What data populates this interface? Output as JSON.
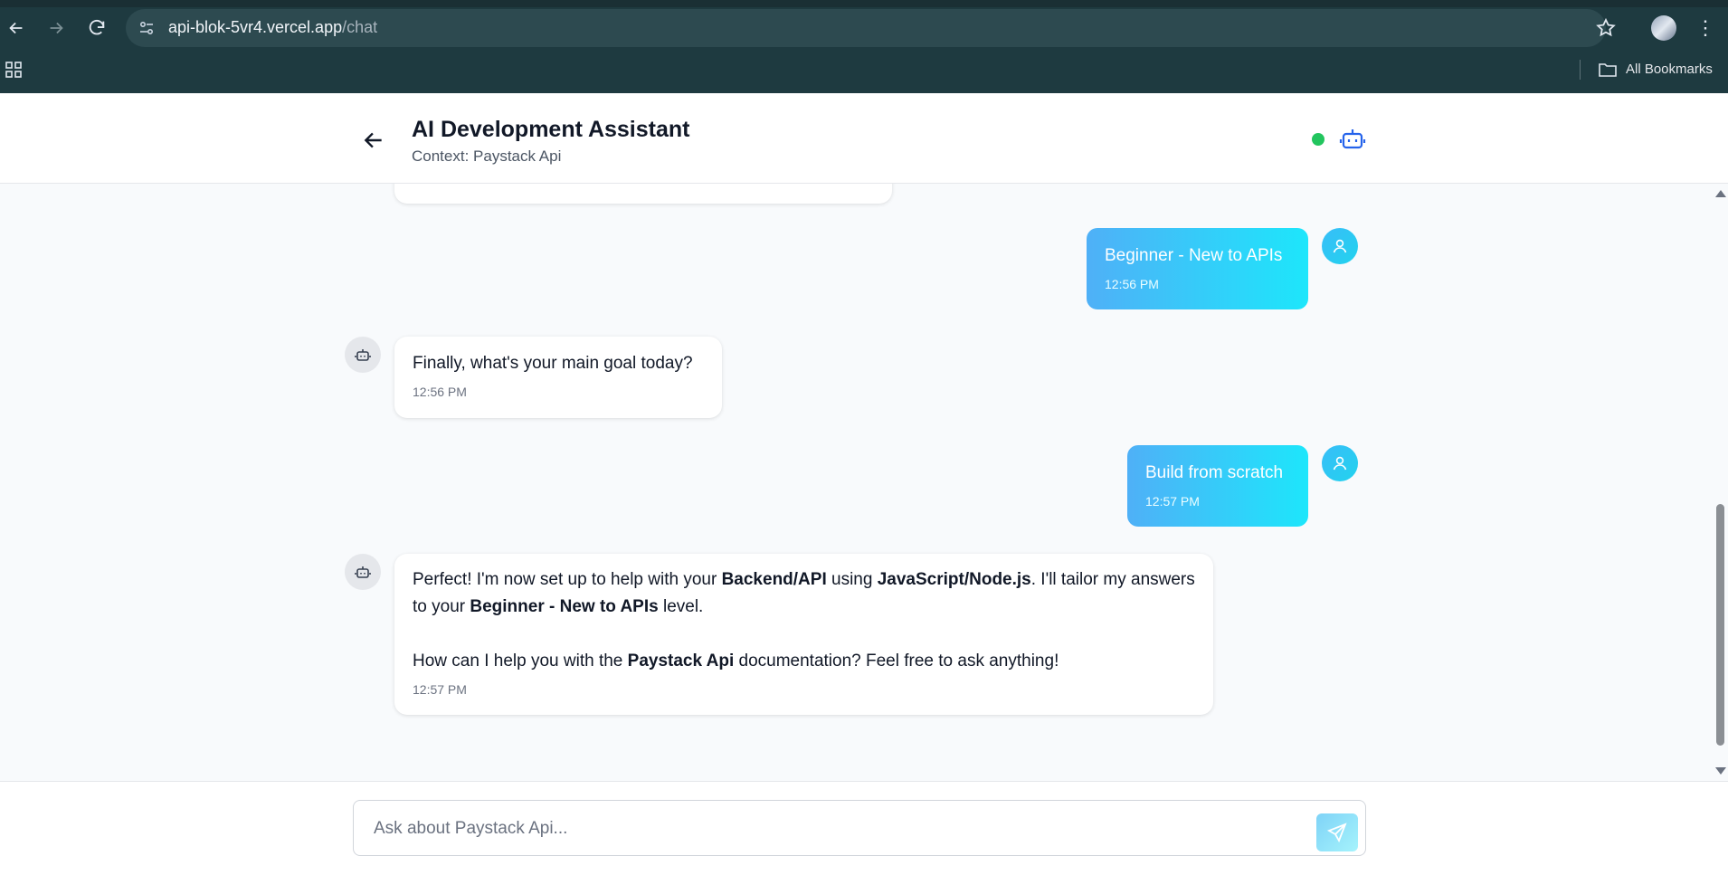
{
  "browser": {
    "url_host": "api-blok-5vr4.vercel.app",
    "url_path": "/chat",
    "bookmarks_label": "All Bookmarks"
  },
  "header": {
    "title": "AI Development Assistant",
    "subtitle": "Context: Paystack Api",
    "status_color": "#22c55e"
  },
  "messages": [
    {
      "role": "user",
      "text": "Beginner - New to APIs",
      "time": "12:56 PM"
    },
    {
      "role": "assistant",
      "text": "Finally, what's your main goal today?",
      "time": "12:56 PM"
    },
    {
      "role": "user",
      "text": "Build from scratch",
      "time": "12:57 PM"
    },
    {
      "role": "assistant",
      "line1": {
        "p1": "Perfect! I'm now set up to help with your ",
        "b1": "Backend/API",
        "p2": " using ",
        "b2": "JavaScript/Node.js",
        "p3": ". I'll tailor my answers to your ",
        "b3": "Beginner - New to APIs",
        "p4": " level."
      },
      "line2": {
        "p1": "How can I help you with the ",
        "b1": "Paystack Api",
        "p2": " documentation? Feel free to ask anything!"
      },
      "time": "12:57 PM"
    }
  ],
  "input": {
    "placeholder": "Ask about Paystack Api...",
    "value": ""
  },
  "colors": {
    "accent": "#2563eb",
    "user_bubble_start": "#4fb0f7",
    "user_bubble_end": "#1de6fb"
  },
  "icons": {
    "back": "arrow-left-icon",
    "header_bot": "bot-icon",
    "user_avatar": "user-icon",
    "bot_avatar": "bot-icon",
    "send": "send-icon"
  }
}
